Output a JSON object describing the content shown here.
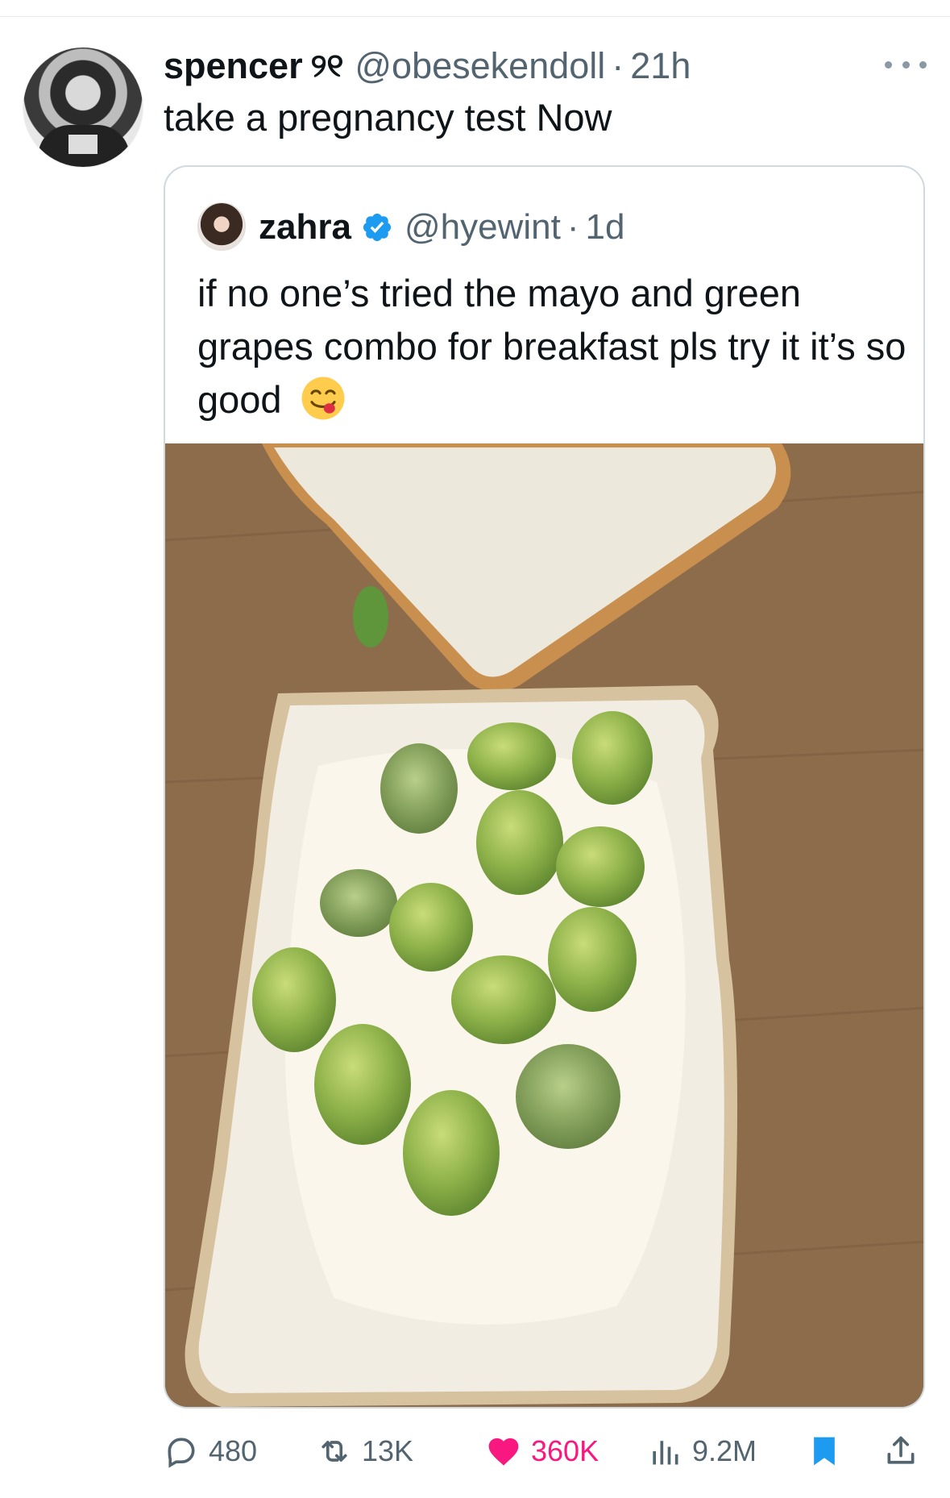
{
  "tweet": {
    "display_name": "spencer",
    "name_emoji": "୨୧",
    "handle": "@obesekendoll",
    "separator": "·",
    "time": "21h",
    "text": "take a pregnancy test Now",
    "avatar_icon": "profile-photo"
  },
  "quoted_tweet": {
    "display_name": "zahra",
    "verified_icon": "verified-badge-icon",
    "handle": "@hyewint",
    "separator": "·",
    "time": "1d",
    "text": "if no one’s tried the mayo and green grapes combo for breakfast pls try it it’s so good",
    "emoji_icon": "face-savoring-food-emoji"
  },
  "actions": {
    "replies": "480",
    "reposts": "13K",
    "likes": "360K",
    "views": "9.2M"
  },
  "colors": {
    "text_primary": "#0f1419",
    "text_secondary": "#536471",
    "like_pink": "#f91880",
    "bookmark_blue": "#1d9bf0",
    "border": "#cfd9de"
  }
}
